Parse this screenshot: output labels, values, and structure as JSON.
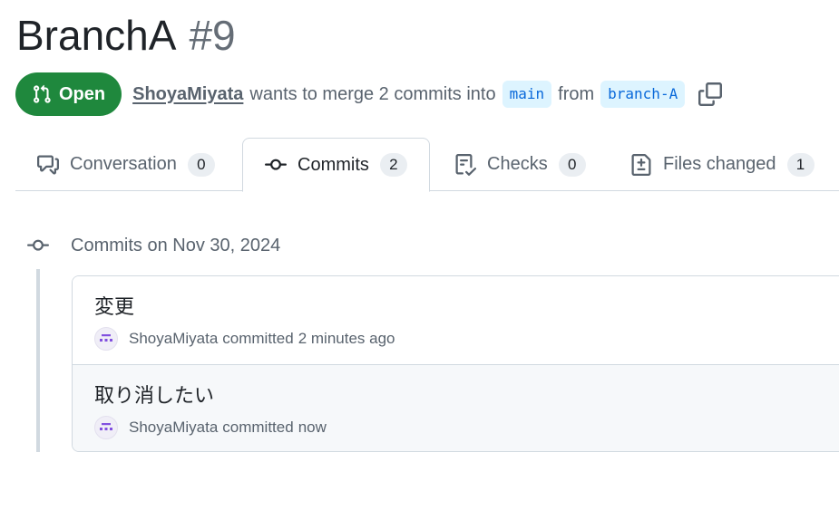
{
  "pr": {
    "title": "BranchA",
    "number": "#9",
    "state": "Open",
    "author": "ShoyaMiyata",
    "merge_text": "wants to merge 2 commits into",
    "base_branch": "main",
    "from_text": "from",
    "head_branch": "branch-A"
  },
  "tabs": [
    {
      "label": "Conversation",
      "count": "0",
      "icon": "comment-discussion-icon",
      "selected": false
    },
    {
      "label": "Commits",
      "count": "2",
      "icon": "git-commit-icon",
      "selected": true
    },
    {
      "label": "Checks",
      "count": "0",
      "icon": "checklist-icon",
      "selected": false
    },
    {
      "label": "Files changed",
      "count": "1",
      "icon": "file-diff-icon",
      "selected": false
    }
  ],
  "commits_group": {
    "header": "Commits on Nov 30, 2024",
    "commits": [
      {
        "message": "変更",
        "author": "ShoyaMiyata",
        "action": "committed",
        "time": "2 minutes ago"
      },
      {
        "message": "取り消したい",
        "author": "ShoyaMiyata",
        "action": "committed",
        "time": "now"
      }
    ]
  },
  "colors": {
    "open_badge": "#1f883d",
    "branch_pill_bg": "#ddf4ff",
    "branch_pill_text": "#0969da",
    "muted_text": "#59636e",
    "border": "#d1d9e0",
    "avatar_accent": "#8250df"
  }
}
